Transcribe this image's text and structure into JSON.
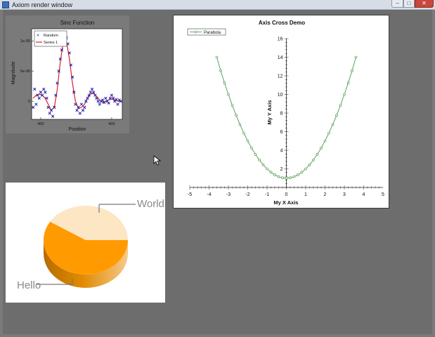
{
  "window": {
    "title": "Axiom render window",
    "minimize_glyph": "–",
    "maximize_glyph": "□",
    "close_glyph": "✕"
  },
  "colors": {
    "background": "#6d6d6d",
    "sinc_random": "#1a1aa0",
    "sinc_series": "#e02020",
    "parabola": "#3a8a3a",
    "pie_orange": "#ff9a00",
    "pie_light": "#fde6c4"
  },
  "chart_data": [
    {
      "type": "scatter",
      "title": "Sinc Function",
      "xlabel": "Position",
      "ylabel": "Magnitude",
      "xlim": [
        360,
        420
      ],
      "ylim": [
        -3e-06,
        1.2e-05
      ],
      "x_ticks": [
        "400",
        "400"
      ],
      "x_tick_values": [
        366,
        413
      ],
      "y_ticks": [
        "1e-05",
        "5e-06",
        "0"
      ],
      "y_tick_values": [
        1e-05,
        5e-06,
        0
      ],
      "legend": "top-left",
      "series": [
        {
          "name": "Random",
          "marker": "x",
          "x": [
            361,
            362,
            363,
            364,
            365,
            366,
            367,
            368,
            369,
            370,
            371,
            372,
            373,
            374,
            375,
            376,
            377,
            378,
            379,
            380,
            381,
            382,
            383,
            384,
            385,
            386,
            387,
            388,
            389,
            390,
            391,
            392,
            393,
            394,
            395,
            396,
            397,
            398,
            399,
            400,
            401,
            402,
            403,
            404,
            405,
            406,
            407,
            408,
            409,
            410,
            411,
            412,
            413,
            414,
            415,
            416,
            417,
            418,
            419
          ],
          "y": [
            -1e-06,
            2e-06,
            -5e-07,
            1e-06,
            5e-07,
            1.5e-06,
            1e-06,
            2e-06,
            1.5e-06,
            5e-07,
            -1e-06,
            -2e-06,
            -1.5e-06,
            -2.5e-06,
            -1e-06,
            1e-06,
            3e-06,
            5e-06,
            7e-06,
            8.5e-06,
            1e-05,
            1.1e-05,
            1.05e-05,
            9.5e-06,
            8e-06,
            6e-06,
            4e-06,
            1.5e-06,
            -5e-07,
            -1.5e-06,
            -1e-06,
            -2e-06,
            -5e-07,
            -1.5e-06,
            -1e-06,
            0.0,
            5e-07,
            1e-06,
            1.5e-06,
            2e-06,
            1.5e-06,
            1e-06,
            5e-07,
            0.0,
            -5e-07,
            0.0,
            2e-07,
            -2e-07,
            5e-07,
            0.0,
            -3e-07,
            5e-07,
            1e-06,
            5e-07,
            0.0,
            3e-07,
            -5e-07,
            2e-07,
            0.0
          ]
        },
        {
          "name": "Series 1",
          "marker": "line",
          "x": [
            361,
            363,
            365,
            367,
            369,
            371,
            373,
            375,
            377,
            379,
            381,
            382,
            383,
            385,
            387,
            389,
            391,
            393,
            395,
            397,
            399,
            401,
            403,
            405,
            407,
            409,
            411,
            413,
            415,
            417,
            419
          ],
          "y": [
            5e-07,
            1e-06,
            1.2e-06,
            1e-06,
            5e-07,
            -5e-07,
            -1.5e-06,
            -1e-06,
            2e-06,
            6.5e-06,
            1e-05,
            1.05e-05,
            1e-05,
            7e-06,
            3e-06,
            0.0,
            -1.2e-06,
            -1e-06,
            -5e-07,
            5e-07,
            1.2e-06,
            1.3e-06,
            8e-07,
            2e-07,
            -2e-07,
            0.0,
            2e-07,
            4e-07,
            2e-07,
            0.0,
            0.0
          ]
        }
      ]
    },
    {
      "type": "line",
      "title": "Axis Cross Demo",
      "xlabel": "My X Axis",
      "ylabel": "My Y Axis",
      "xlim": [
        -5,
        5
      ],
      "ylim": [
        0,
        16
      ],
      "x_ticks": [
        "-5",
        "-4",
        "-3",
        "-2",
        "-1",
        "0",
        "1",
        "2",
        "3",
        "4",
        "5"
      ],
      "y_ticks": [
        "2",
        "4",
        "6",
        "8",
        "10",
        "12",
        "14",
        "16"
      ],
      "legend": "top-left",
      "series": [
        {
          "name": "Parabola",
          "x": [
            -3.6,
            -3.4,
            -3.2,
            -3.0,
            -2.8,
            -2.6,
            -2.4,
            -2.2,
            -2.0,
            -1.8,
            -1.6,
            -1.4,
            -1.2,
            -1.0,
            -0.8,
            -0.6,
            -0.4,
            -0.2,
            0.0,
            0.2,
            0.4,
            0.6,
            0.8,
            1.0,
            1.2,
            1.4,
            1.6,
            1.8,
            2.0,
            2.2,
            2.4,
            2.6,
            2.8,
            3.0,
            3.2,
            3.4,
            3.6
          ],
          "y": [
            14.0,
            12.56,
            11.24,
            10.0,
            8.84,
            7.76,
            6.76,
            5.84,
            5.0,
            4.24,
            3.56,
            2.96,
            2.44,
            2.0,
            1.64,
            1.36,
            1.16,
            1.04,
            1.0,
            1.04,
            1.16,
            1.36,
            1.64,
            2.0,
            2.44,
            2.96,
            3.56,
            4.24,
            5.0,
            5.84,
            6.76,
            7.76,
            8.84,
            10.0,
            11.24,
            12.56,
            14.0
          ]
        }
      ]
    },
    {
      "type": "pie",
      "labels": [
        "Hello",
        "World"
      ],
      "values": [
        59,
        41
      ],
      "colors": [
        "#ff9a00",
        "#fde6c4"
      ]
    }
  ]
}
